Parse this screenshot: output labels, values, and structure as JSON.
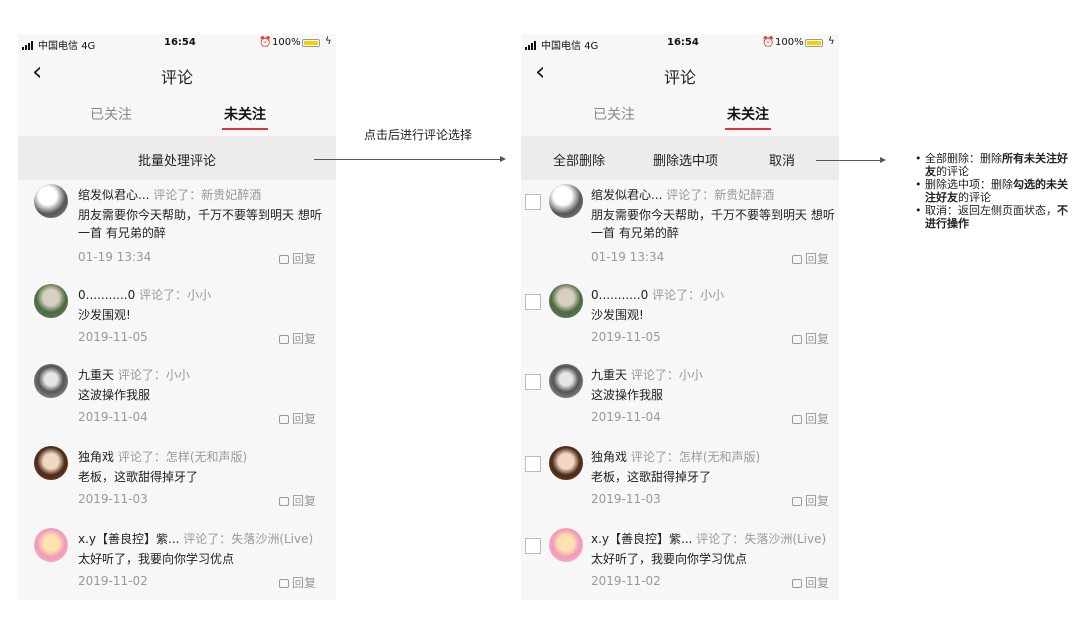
{
  "status_bar": {
    "carrier": "中国电信",
    "network": "4G",
    "time": "16:54",
    "battery": "100%",
    "icons": [
      "signal-icon",
      "alarm-icon",
      "battery-icon",
      "charging-icon"
    ]
  },
  "nav": {
    "back_icon": "chevron-left-icon",
    "title": "评论"
  },
  "tabs": [
    {
      "label": "已关注",
      "active": false
    },
    {
      "label": "未关注",
      "active": true
    }
  ],
  "colors": {
    "accent": "#e0323c",
    "toolbar_bg": "#ececec",
    "muted": "#999999"
  },
  "left_toolbar": {
    "batch_label": "批量处理评论"
  },
  "right_toolbar": {
    "delete_all": "全部删除",
    "delete_selected": "删除选中项",
    "cancel": "取消"
  },
  "arrow_label": "点击后进行评论选择",
  "comments": [
    {
      "user": "绾发似君心...",
      "verb": "评论了：",
      "target": "新贵妃醉酒",
      "body": "朋友需要你今天帮助，千万不要等到明天 想听一首 有兄弟的醉",
      "date": "01-19 13:34",
      "reply": "回复"
    },
    {
      "user": "0...........0",
      "verb": "评论了：",
      "target": "小小",
      "body": "沙发围观!",
      "date": "2019-11-05",
      "reply": "回复"
    },
    {
      "user": "九重天",
      "verb": "评论了：",
      "target": "小小",
      "body": "这波操作我服",
      "date": "2019-11-04",
      "reply": "回复"
    },
    {
      "user": "独角戏",
      "verb": "评论了：",
      "target": "怎样(无和声版)",
      "body": "老板，这歌甜得掉牙了",
      "date": "2019-11-03",
      "reply": "回复"
    },
    {
      "user": "x.y【善良控】紫...",
      "verb": "评论了：",
      "target": "失落沙洲(Live)",
      "body": "太好听了，我要向你学习优点",
      "date": "2019-11-02",
      "reply": "回复"
    }
  ],
  "notes": [
    {
      "a": "全部删除：删除",
      "b": "所有未关注好友",
      "c": "的评论"
    },
    {
      "a": "删除选中项：删除",
      "b": "勾选的未关注好友",
      "c": "的评论"
    },
    {
      "a": "取消：返回左侧页面状态，",
      "b": "不进行操作",
      "c": ""
    }
  ]
}
